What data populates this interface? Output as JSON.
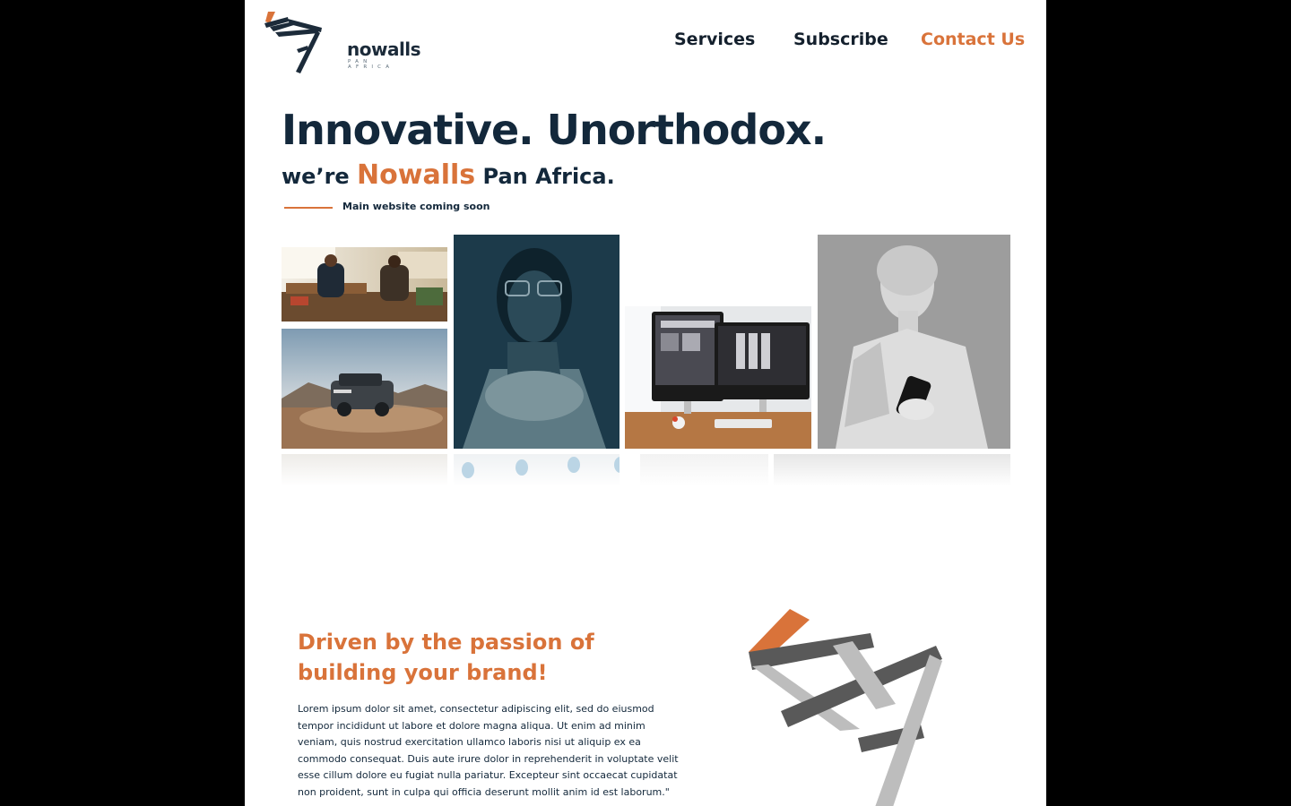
{
  "header": {
    "logo_word": "nowalls",
    "logo_sub": "PAN AFRICA",
    "nav": [
      {
        "label": "Services"
      },
      {
        "label": "Subscribe"
      },
      {
        "label": "Contact Us"
      }
    ]
  },
  "hero": {
    "title": "Innovative. Unorthodox.",
    "sub_prefix": "we’re",
    "sub_brand": "Nowalls",
    "sub_suffix": "Pan Africa.",
    "coming_soon": "Main website coming soon"
  },
  "gallery": {
    "images": [
      "office-meeting-photo",
      "suv-desert-photo",
      "woman-portrait-photo",
      "computer-desk-photo",
      "statue-phone-photo"
    ]
  },
  "about": {
    "tagline": "Driven by the passion of building your brand!",
    "body": "Lorem ipsum dolor sit amet, consectetur adipiscing elit, sed do eiusmod tempor incididunt ut labore et dolore magna aliqua. Ut enim ad minim veniam, quis nostrud exercitation ullamco laboris nisi ut aliquip ex ea commodo consequat. Duis aute irure dolor in reprehenderit in voluptate velit esse cillum dolore eu fugiat nulla pariatur. Excepteur sint occaecat cupidatat non proident, sunt in culpa qui officia deserunt mollit anim id est laborum.\""
  },
  "colors": {
    "accent": "#d9733a",
    "navy": "#13283b",
    "background": "#ffffff"
  }
}
